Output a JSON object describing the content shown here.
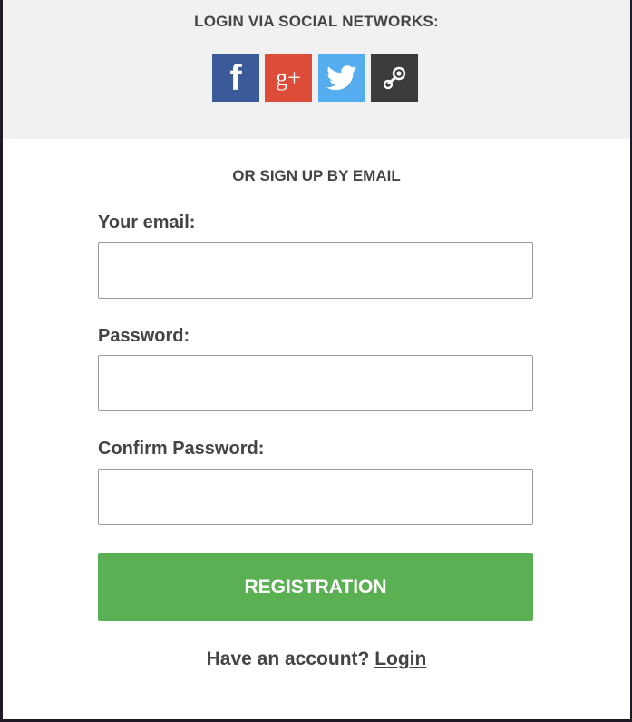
{
  "social": {
    "title": "LOGIN VIA SOCIAL NETWORKS:",
    "buttons": [
      {
        "name": "facebook",
        "icon": "facebook-icon",
        "glyph": "f",
        "color": "#3b5a9a"
      },
      {
        "name": "google-plus",
        "icon": "google-plus-icon",
        "glyph": "g+",
        "color": "#dd4b39"
      },
      {
        "name": "twitter",
        "icon": "twitter-icon",
        "color": "#55acee"
      },
      {
        "name": "steam",
        "icon": "steam-icon",
        "color": "#3c3c3c"
      }
    ]
  },
  "signup": {
    "title": "OR SIGN UP BY EMAIL",
    "email_label": "Your email:",
    "email_value": "",
    "password_label": "Password:",
    "password_value": "",
    "confirm_label": "Confirm Password:",
    "confirm_value": "",
    "submit_label": "REGISTRATION"
  },
  "footer": {
    "prompt": "Have an account?",
    "login_link": "Login"
  },
  "colors": {
    "panel_bg": "#f1f1f1",
    "text": "#444444",
    "accent_green": "#5cb054"
  }
}
